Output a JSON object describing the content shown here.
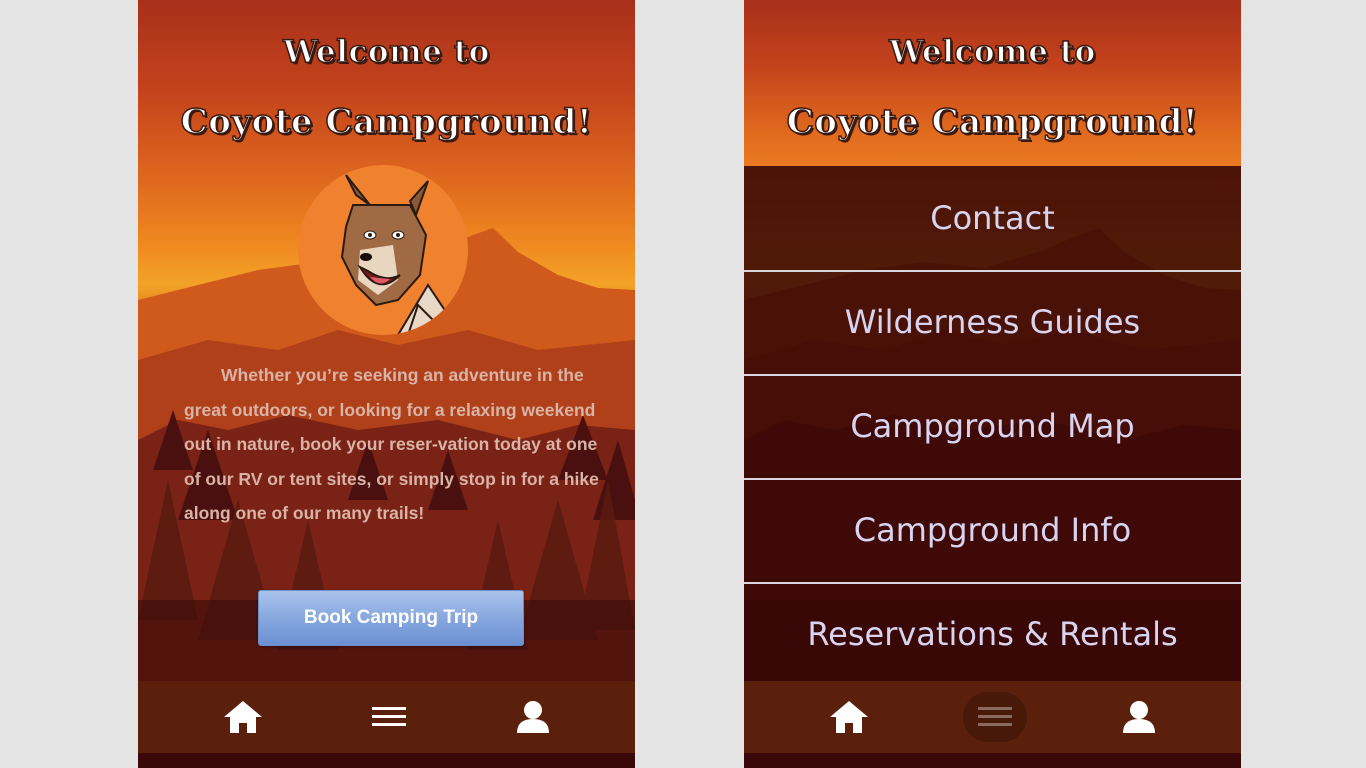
{
  "screens": [
    {
      "title_line1": "Welcome to",
      "title_line2": "Coyote Campground!",
      "intro_text": "Whether you’re seeking an adventure in the great outdoors, or looking for a relaxing weekend out in nature, book your reser-vation today at one of our RV or tent sites, or simply stop in for a hike along one of our many trails!",
      "book_button_label": "Book Camping Trip",
      "nav": {
        "home_icon": "home-icon",
        "menu_icon": "hamburger-menu-icon",
        "profile_icon": "user-profile-icon"
      }
    },
    {
      "title_line1": "Welcome to",
      "title_line2": "Coyote Campground!",
      "menu_items": [
        "Contact",
        "Wilderness Guides",
        "Campground Map",
        "Campground Info",
        "Reservations & Rentals"
      ],
      "nav": {
        "home_icon": "home-icon",
        "menu_icon": "hamburger-menu-icon",
        "profile_icon": "user-profile-icon",
        "active": "menu"
      }
    }
  ],
  "colors": {
    "page_background": "#e4e4e4",
    "nav_bar": "#5a200c",
    "button_blue": "#8aaae0",
    "menu_text": "#d8d4f0",
    "title_text": "#ffffff"
  }
}
